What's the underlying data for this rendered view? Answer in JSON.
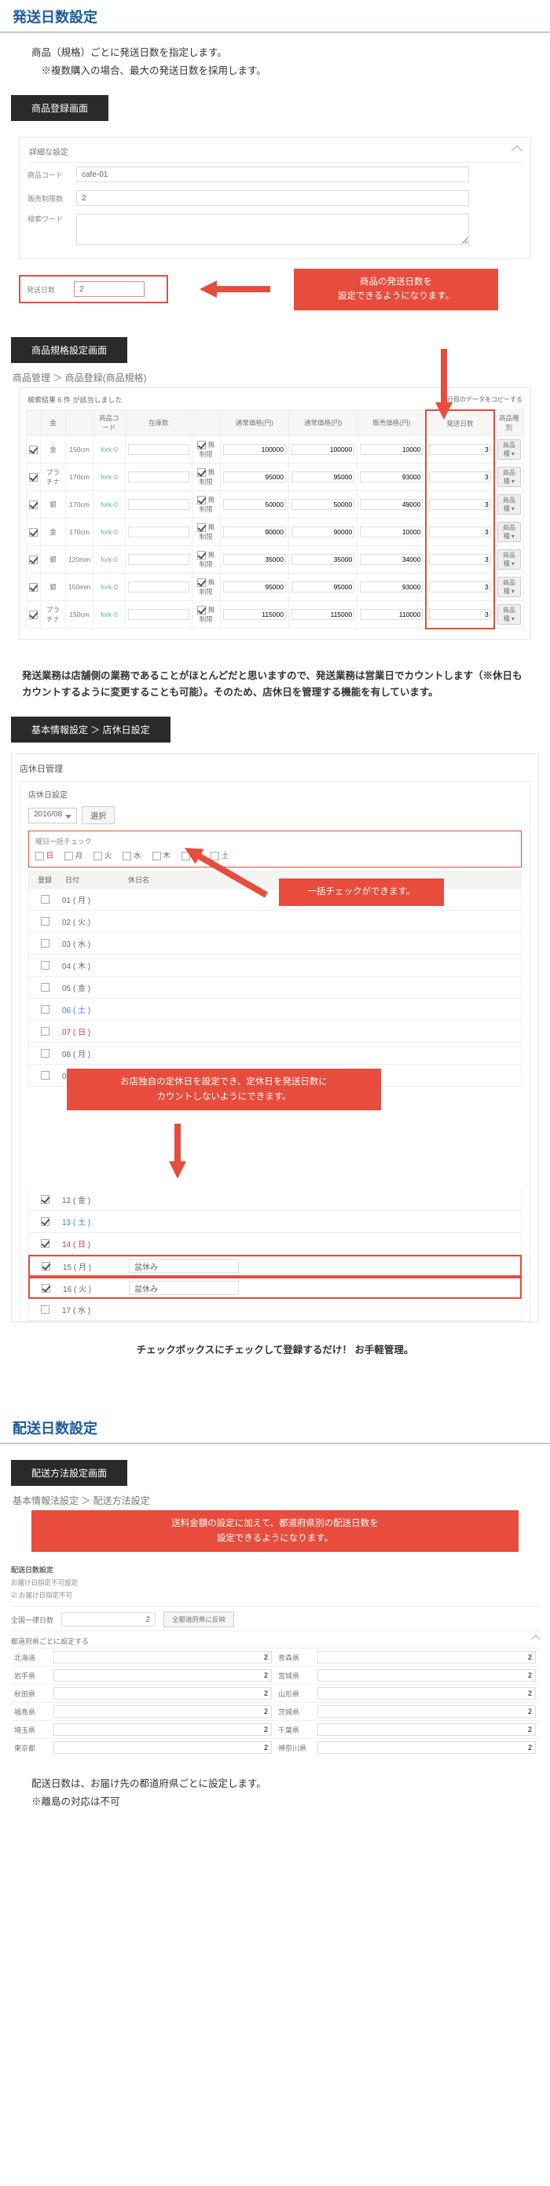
{
  "section1": {
    "title": "発送日数設定",
    "desc1": "商品（規格）ごとに発送日数を指定します。",
    "desc2": "※複数購入の場合、最大の発送日数を採用します。",
    "tab1": "商品登録画面",
    "detail_header": "詳細な設定",
    "rows": {
      "code_label": "商品コード",
      "code_value": "cafe-01",
      "limit_label": "販売制限数",
      "limit_value": "2",
      "keyword_label": "検索ワード",
      "days_label": "発送日数",
      "days_value": "2"
    },
    "callout1_l1": "商品の発送日数を",
    "callout1_l2": "設定できるようになります。",
    "tab2": "商品規格設定画面",
    "breadcrumb": "商品管理 ＞ 商品登録(商品規格)",
    "spec_head": "検索結果  6 件 が該当しました",
    "spec_copy_note": "1行目のデータをコピーする",
    "spec_cols": [
      "",
      "金",
      "",
      "商品コード",
      "在庫数",
      "",
      "通常価格(円)",
      "通常価格(円)",
      "販売価格(円)",
      "発送日数",
      "商品種別"
    ],
    "spec_rows": [
      {
        "a": "金",
        "b": "150cm",
        "code": "fork-0",
        "stock": "",
        "unlim": "無制限",
        "p1": "100000",
        "p2": "100000",
        "p3": "10000",
        "days": "3",
        "type": "商品種"
      },
      {
        "a": "プラチナ",
        "b": "170cm",
        "code": "fork-0",
        "stock": "",
        "unlim": "無制限",
        "p1": "95000",
        "p2": "95000",
        "p3": "93000",
        "days": "3",
        "type": "商品種"
      },
      {
        "a": "銀",
        "b": "170cm",
        "code": "fork-0",
        "stock": "",
        "unlim": "無制限",
        "p1": "50000",
        "p2": "50000",
        "p3": "49000",
        "days": "3",
        "type": "商品種"
      },
      {
        "a": "金",
        "b": "170cm",
        "code": "fork-0",
        "stock": "",
        "unlim": "無制限",
        "p1": "90000",
        "p2": "90000",
        "p3": "10000",
        "days": "3",
        "type": "商品種"
      },
      {
        "a": "銀",
        "b": "120mm",
        "code": "fork-0",
        "stock": "",
        "unlim": "無制限",
        "p1": "35000",
        "p2": "35000",
        "p3": "34000",
        "days": "3",
        "type": "商品種"
      },
      {
        "a": "銀",
        "b": "150mm",
        "code": "fork-0",
        "stock": "",
        "unlim": "無制限",
        "p1": "95000",
        "p2": "95000",
        "p3": "93000",
        "days": "3",
        "type": "商品種"
      },
      {
        "a": "プラチナ",
        "b": "150cm",
        "code": "fork-0",
        "stock": "",
        "unlim": "無制限",
        "p1": "115000",
        "p2": "115000",
        "p3": "110000",
        "days": "3",
        "type": "商品種"
      }
    ],
    "para2": "発送業務は店舗側の業務であることがほとんどだと思いますので、発送業務は営業日でカウントします（※休日もカウントするように変更することも可能）。そのため、店休日を管理する機能を有しています。",
    "tab3": "基本情報設定 ＞ 店休日設定",
    "holiday_h1": "店休日管理",
    "holiday_h2": "店休日設定",
    "month_value": "2016/08",
    "month_btn": "選択",
    "weekday_title": "曜日一括チェック",
    "weekdays": [
      "日",
      "月",
      "火",
      "水",
      "木",
      "金",
      "土"
    ],
    "cal_cols": [
      "登録",
      "日付",
      "休日名"
    ],
    "callout2": "一括チェックができます。",
    "callout3_l1": "お店独自の定休日を設定でき、定休日を発送日数に",
    "callout3_l2": "カウントしないようにできます。",
    "cal_rows": [
      {
        "chk": false,
        "date": "01 ( 月 )",
        "cls": "",
        "name": ""
      },
      {
        "chk": false,
        "date": "02 ( 火 )",
        "cls": "",
        "name": ""
      },
      {
        "chk": false,
        "date": "03 ( 水 )",
        "cls": "",
        "name": ""
      },
      {
        "chk": false,
        "date": "04 ( 木 )",
        "cls": "",
        "name": ""
      },
      {
        "chk": false,
        "date": "05 ( 金 )",
        "cls": "",
        "name": ""
      },
      {
        "chk": false,
        "date": "06 ( 土 )",
        "cls": "date-sat",
        "name": ""
      },
      {
        "chk": false,
        "date": "07 ( 日 )",
        "cls": "date-sun",
        "name": ""
      },
      {
        "chk": false,
        "date": "08 ( 月 )",
        "cls": "",
        "name": ""
      },
      {
        "chk": false,
        "date": "09 ( 火 )",
        "cls": "",
        "name": ""
      },
      {
        "chk": true,
        "date": "12 ( 金 )",
        "cls": "",
        "name": ""
      },
      {
        "chk": true,
        "date": "13 ( 土 )",
        "cls": "date-sat",
        "name": ""
      },
      {
        "chk": true,
        "date": "14 ( 日 )",
        "cls": "date-sun",
        "name": ""
      },
      {
        "chk": true,
        "date": "15 ( 月 )",
        "cls": "",
        "name": "盆休み",
        "red": true
      },
      {
        "chk": true,
        "date": "16 ( 火 )",
        "cls": "",
        "name": "盆休み",
        "red": true
      },
      {
        "chk": false,
        "date": "17 ( 水 )",
        "cls": "",
        "name": ""
      }
    ],
    "tail_note": "チェックボックスにチェックして登録するだけ！ お手軽管理。"
  },
  "section2": {
    "title": "配送日数設定",
    "tab1": "配送方法設定画面",
    "breadcrumb": "基本情報法設定 ＞ 配送方法設定",
    "callout_l1": "送料金額の設定に加えて、都道府県別の配送日数を",
    "callout_l2": "設定できるようになります。",
    "subhead1": "配送日数設定",
    "sub1_l1": "お届け日指定不可設定",
    "sub1_l2": "☑ お届け日指定不可",
    "sub2_label": "全国一律日数",
    "sub2_value": "2",
    "sub2_btn": "全都道府県に反映",
    "sub3": "都道府県ごとに設定する",
    "prefs": [
      [
        "北海道",
        "2",
        "青森県",
        "2"
      ],
      [
        "岩手県",
        "2",
        "宮城県",
        "2"
      ],
      [
        "秋田県",
        "2",
        "山形県",
        "2"
      ],
      [
        "福島県",
        "2",
        "茨城県",
        "2"
      ],
      [
        "埼玉県",
        "2",
        "千葉県",
        "2"
      ],
      [
        "東京都",
        "2",
        "神奈川県",
        "2"
      ]
    ],
    "note1": "配送日数は、お届け先の都道府県ごとに設定します。",
    "note2": "※離島の対応は不可"
  }
}
